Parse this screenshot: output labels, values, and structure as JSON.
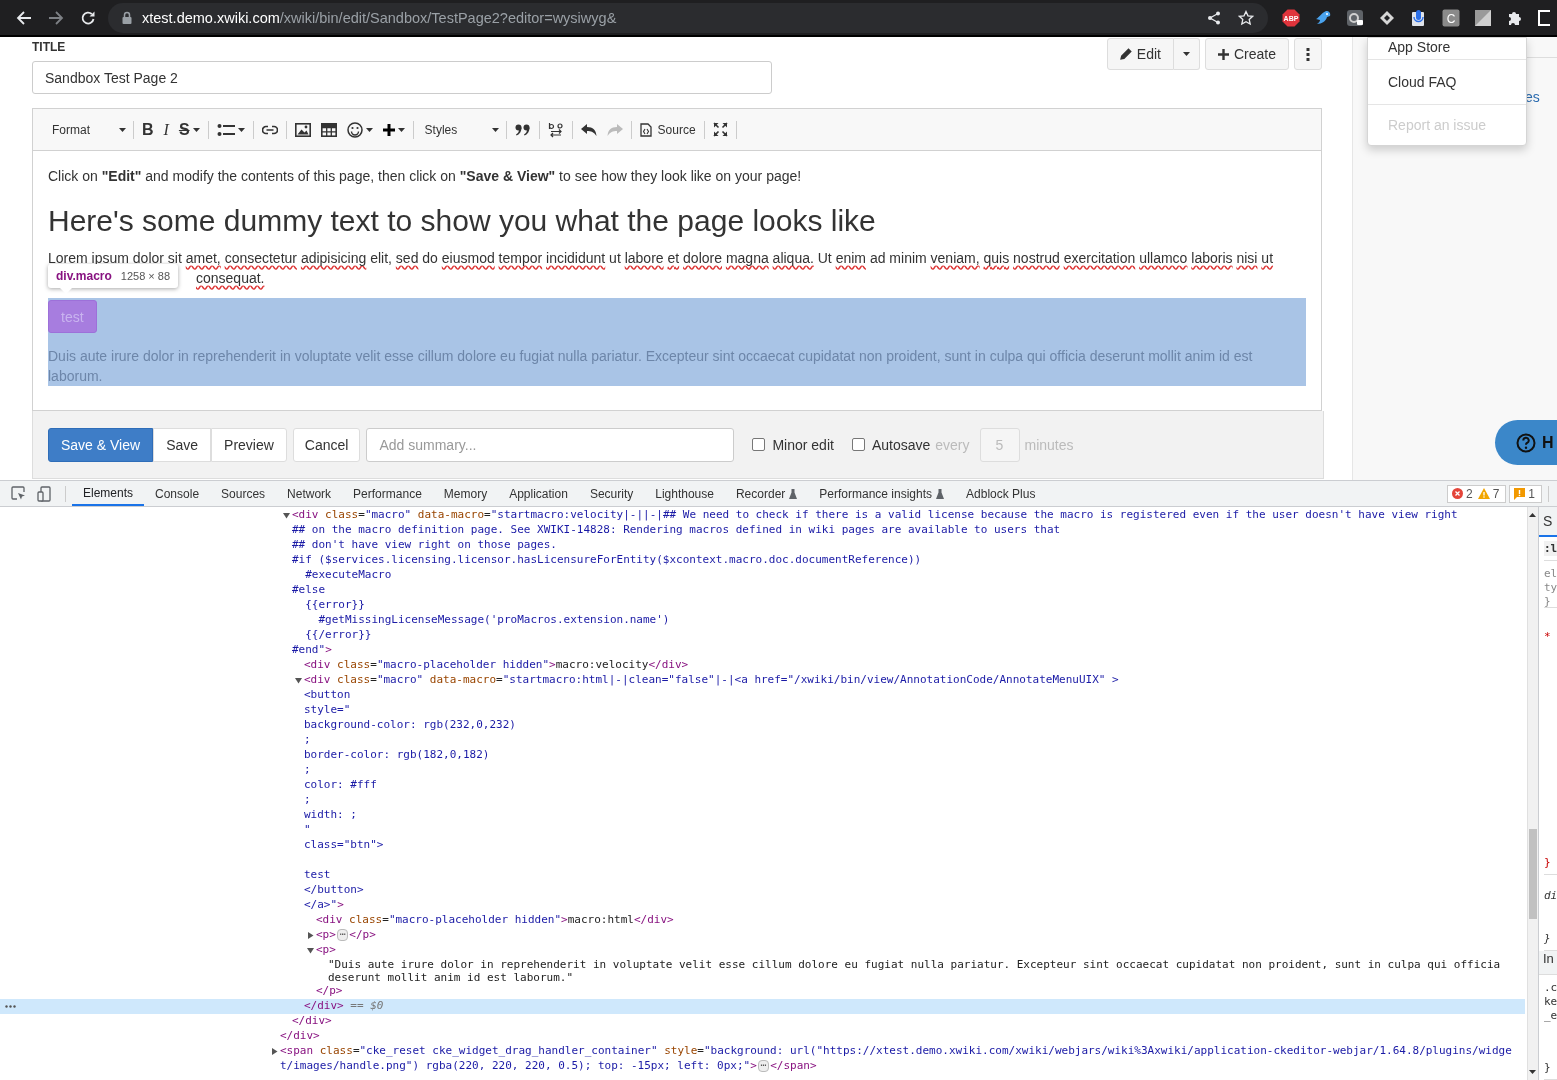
{
  "browser": {
    "host": "xtest.demo.xwiki.com",
    "path": "/xwiki/bin/edit/Sandbox/TestPage2?editor=wysiwyg&",
    "forward_disabled": true,
    "adblock_label": "ABP",
    "c_extension_label": "C"
  },
  "page": {
    "title_label": "TITLE",
    "title_value": "Sandbox Test Page 2",
    "actions": {
      "edit": "Edit",
      "create": "Create"
    },
    "toolbar": [
      [
        {
          "kind": "combo",
          "label": "Format"
        }
      ],
      [
        {
          "kind": "bold",
          "glyph": "B",
          "dropdown": false
        },
        {
          "kind": "italic",
          "glyph": "I",
          "dropdown": false
        },
        {
          "kind": "strike",
          "glyph": "S",
          "dropdown": true
        }
      ],
      [
        {
          "kind": "icon",
          "dropdown": true,
          "disabled": false
        }
      ],
      [
        {
          "kind": "icon",
          "dropdown": false,
          "disabled": false
        }
      ],
      [
        {
          "kind": "icon",
          "dropdown": false,
          "disabled": false
        },
        {
          "kind": "icon",
          "dropdown": false,
          "disabled": false
        },
        {
          "kind": "icon",
          "dropdown": true,
          "disabled": false
        },
        {
          "kind": "icon",
          "dropdown": true,
          "disabled": false
        }
      ],
      [
        {
          "kind": "combo",
          "label": "Styles"
        }
      ],
      [
        {
          "kind": "icon",
          "dropdown": false,
          "disabled": false
        }
      ],
      [
        {
          "kind": "icon",
          "dropdown": false,
          "disabled": false
        }
      ],
      [
        {
          "kind": "icon",
          "dropdown": false,
          "disabled": false
        },
        {
          "kind": "icon",
          "dropdown": false,
          "disabled": true
        }
      ],
      [
        {
          "kind": "labeled",
          "label": "Source",
          "dropdown": false,
          "disabled": false
        }
      ],
      [
        {
          "kind": "icon",
          "dropdown": false,
          "disabled": false
        }
      ]
    ],
    "content": {
      "intro": "Click on **\"Edit\"** and modify the contents of this page, then click on **\"Save & View\"** to see how they look like on your page!",
      "heading": "Here's some dummy text to show you what the page looks like",
      "lorem": [
        [
          {
            "text": "Lorem ipsum dolor sit",
            "misspelled": false
          },
          {
            "text": "amet,",
            "misspelled": true
          },
          {
            "text": "consectetur",
            "misspelled": true
          },
          {
            "text": "adipisicing",
            "misspelled": true
          },
          {
            "text": "elit,",
            "misspelled": false
          },
          {
            "text": "sed",
            "misspelled": true
          },
          {
            "text": "do",
            "misspelled": false
          },
          {
            "text": "eiusmod",
            "misspelled": true
          },
          {
            "text": "tempor",
            "misspelled": true
          },
          {
            "text": "incididunt",
            "misspelled": true
          },
          {
            "text": "ut",
            "misspelled": false
          },
          {
            "text": "labore",
            "misspelled": true
          },
          {
            "text": "et",
            "misspelled": true
          },
          {
            "text": "dolore",
            "misspelled": true
          },
          {
            "text": "magna",
            "misspelled": true
          },
          {
            "text": "aliqua.",
            "misspelled": true
          },
          {
            "text": "Ut",
            "misspelled": false
          },
          {
            "text": "enim",
            "misspelled": true
          },
          {
            "text": "ad minim",
            "misspelled": false
          },
          {
            "text": "veniam,",
            "misspelled": true
          },
          {
            "text": "quis",
            "misspelled": true
          },
          {
            "text": "nostrud",
            "misspelled": true
          },
          {
            "text": "exercitation",
            "misspelled": true
          },
          {
            "text": "ullamco",
            "misspelled": true
          },
          {
            "text": "laboris",
            "misspelled": true
          },
          {
            "text": "nisi",
            "misspelled": true
          },
          {
            "text": "ut",
            "misspelled": true
          }
        ],
        [
          {
            "text": "consequat.",
            "misspelled": true
          }
        ]
      ],
      "tooltip": {
        "selector": "div.macro",
        "size": "1258 × 88"
      },
      "macro": {
        "selected": true,
        "button": "test",
        "text": "Duis aute irure dolor in reprehenderit in voluptate velit esse cillum dolore eu fugiat nulla pariatur. Excepteur sint occaecat cupidatat non proident, sunt in culpa qui officia deserunt mollit anim id est laborum."
      }
    },
    "footer": {
      "button_groups": [
        [
          {
            "label": "Save & View",
            "primary": true
          },
          {
            "label": "Save",
            "primary": false
          },
          {
            "label": "Preview",
            "primary": false
          }
        ],
        [
          {
            "label": "Cancel",
            "primary": false
          }
        ]
      ],
      "summary": {
        "placeholder": "Add summary..."
      },
      "minor_edit": {
        "label": "Minor edit",
        "checked": false
      },
      "autosave": {
        "label": "Autosave",
        "checked": false,
        "prefix": "every",
        "interval": "5",
        "suffix": "minutes"
      }
    }
  },
  "side_panel": {
    "link": "es",
    "menu": [
      {
        "label": "App Store",
        "disabled": false
      },
      {
        "label": "Cloud FAQ",
        "disabled": false
      },
      {
        "label": "Report an issue",
        "disabled": true
      }
    ],
    "help_button": "H"
  },
  "devtools": {
    "tabs": [
      {
        "label": "Elements",
        "selected": true,
        "experimental": false
      },
      {
        "label": "Console",
        "selected": false,
        "experimental": false
      },
      {
        "label": "Sources",
        "selected": false,
        "experimental": false
      },
      {
        "label": "Network",
        "selected": false,
        "experimental": false
      },
      {
        "label": "Performance",
        "selected": false,
        "experimental": false
      },
      {
        "label": "Memory",
        "selected": false,
        "experimental": false
      },
      {
        "label": "Application",
        "selected": false,
        "experimental": false
      },
      {
        "label": "Security",
        "selected": false,
        "experimental": false
      },
      {
        "label": "Lighthouse",
        "selected": false,
        "experimental": false
      },
      {
        "label": "Recorder",
        "selected": false,
        "experimental": true
      },
      {
        "label": "Performance insights",
        "selected": false,
        "experimental": true
      },
      {
        "label": "Adblock Plus",
        "selected": false,
        "experimental": false
      }
    ],
    "counts": {
      "errors": "2",
      "warnings": "7",
      "issues": "1"
    },
    "tree": [
      {
        "kind": "element",
        "selected": false,
        "children": [
          {
            "kind": "element",
            "expanded": true,
            "selected": false,
            "lines": [
              [
                {
                  "kind": "tag",
                  "text": "<div"
                },
                {
                  "kind": "attr",
                  "text": " class"
                },
                {
                  "kind": "punct",
                  "text": "="
                },
                {
                  "kind": "val",
                  "text": "\"macro\""
                },
                {
                  "kind": "attr",
                  "text": " data-macro"
                },
                {
                  "kind": "punct",
                  "text": "="
                },
                {
                  "kind": "val",
                  "text": "\"startmacro:velocity|-||-|## We need to check if there is a valid license because the macro is registered even if the user doesn't have view right"
                }
              ],
              [
                {
                  "kind": "val",
                  "text": "## on the macro definition page. See XWIKI-14828: Rendering macros defined in wiki pages are available to users that"
                }
              ],
              [
                {
                  "kind": "val",
                  "text": "## don't have view right on those pages."
                }
              ],
              [
                {
                  "kind": "val",
                  "text": "#if ($services.licensing.licensor.hasLicensureForEntity($xcontext.macro.doc.documentReference))"
                }
              ],
              [
                {
                  "kind": "val",
                  "text": "  #executeMacro"
                }
              ],
              [
                {
                  "kind": "val",
                  "text": "#else"
                }
              ],
              [
                {
                  "kind": "val",
                  "text": "  {{error}}"
                }
              ],
              [
                {
                  "kind": "val",
                  "text": "    #getMissingLicenseMessage('proMacros.extension.name')"
                }
              ],
              [
                {
                  "kind": "val",
                  "text": "  {{/error}}"
                }
              ],
              [
                {
                  "kind": "val",
                  "text": "#end\""
                },
                {
                  "kind": "tag",
                  "text": ">"
                }
              ]
            ],
            "children": [
              {
                "kind": "element",
                "selected": false,
                "lines": [
                  [
                    {
                      "kind": "tag",
                      "text": "<div"
                    },
                    {
                      "kind": "attr",
                      "text": " class"
                    },
                    {
                      "kind": "punct",
                      "text": "="
                    },
                    {
                      "kind": "val",
                      "text": "\"macro-placeholder hidden\""
                    },
                    {
                      "kind": "tag",
                      "text": ">"
                    },
                    {
                      "kind": "text",
                      "text": "macro:velocity"
                    },
                    {
                      "kind": "tag",
                      "text": "</div>"
                    }
                  ]
                ]
              },
              {
                "kind": "element",
                "expanded": true,
                "selected": true,
                "lines": [
                  [
                    {
                      "kind": "tag",
                      "text": "<div"
                    },
                    {
                      "kind": "attr",
                      "text": " class"
                    },
                    {
                      "kind": "punct",
                      "text": "="
                    },
                    {
                      "kind": "val",
                      "text": "\"macro\""
                    },
                    {
                      "kind": "attr",
                      "text": " data-macro"
                    },
                    {
                      "kind": "punct",
                      "text": "="
                    },
                    {
                      "kind": "val",
                      "text": "\"startmacro:html|-|clean=\"false\"|-|<a href=\"/xwiki/bin/view/AnnotationCode/AnnotateMenuUIX\" >"
                    }
                  ],
                  [
                    {
                      "kind": "val",
                      "text": "<button"
                    }
                  ],
                  [
                    {
                      "kind": "val",
                      "text": "style=\""
                    }
                  ],
                  [
                    {
                      "kind": "val",
                      "text": "background-color: rgb(232,0,232)"
                    }
                  ],
                  [
                    {
                      "kind": "val",
                      "text": ";"
                    }
                  ],
                  [
                    {
                      "kind": "val",
                      "text": "border-color: rgb(182,0,182)"
                    }
                  ],
                  [
                    {
                      "kind": "val",
                      "text": ";"
                    }
                  ],
                  [
                    {
                      "kind": "val",
                      "text": "color: #fff"
                    }
                  ],
                  [
                    {
                      "kind": "val",
                      "text": ";"
                    }
                  ],
                  [
                    {
                      "kind": "val",
                      "text": "width: ;"
                    }
                  ],
                  [
                    {
                      "kind": "val",
                      "text": "\""
                    }
                  ],
                  [
                    {
                      "kind": "val",
                      "text": "class=\"btn\">"
                    }
                  ],
                  [
                    {
                      "kind": "blank"
                    }
                  ],
                  [
                    {
                      "kind": "val",
                      "text": "test"
                    }
                  ],
                  [
                    {
                      "kind": "val",
                      "text": "</button>"
                    }
                  ],
                  [
                    {
                      "kind": "val",
                      "text": "</a>\""
                    },
                    {
                      "kind": "tag",
                      "text": ">"
                    }
                  ]
                ],
                "children": [
                  {
                    "kind": "element",
                    "selected": false,
                    "lines": [
                      [
                        {
                          "kind": "tag",
                          "text": "<div"
                        },
                        {
                          "kind": "attr",
                          "text": " class"
                        },
                        {
                          "kind": "punct",
                          "text": "="
                        },
                        {
                          "kind": "val",
                          "text": "\"macro-placeholder hidden\""
                        },
                        {
                          "kind": "tag",
                          "text": ">"
                        },
                        {
                          "kind": "text",
                          "text": "macro:html"
                        },
                        {
                          "kind": "tag",
                          "text": "</div>"
                        }
                      ]
                    ]
                  },
                  {
                    "kind": "element",
                    "expanded": false,
                    "selected": false,
                    "lines": [
                      [
                        {
                          "kind": "tag",
                          "text": "<p>"
                        },
                        {
                          "kind": "badge",
                          "text": "⋯"
                        },
                        {
                          "kind": "tag",
                          "text": "</p>"
                        }
                      ]
                    ]
                  },
                  {
                    "kind": "element",
                    "expanded": true,
                    "selected": false,
                    "lines": [
                      [
                        {
                          "kind": "tag",
                          "text": "<p>"
                        }
                      ]
                    ],
                    "children": [
                      {
                        "kind": "text",
                        "lines": [
                          [
                            {
                              "kind": "text",
                              "text": "\"Duis aute irure dolor in reprehenderit in voluptate velit esse cillum dolore eu fugiat nulla pariatur. Excepteur sint occaecat cupidatat non proident, sunt in culpa qui officia deserunt mollit anim id est laborum.\""
                            }
                          ]
                        ]
                      }
                    ],
                    "close": [
                      {
                        "kind": "tag",
                        "text": "</p>"
                      }
                    ]
                  }
                ],
                "close": [
                  {
                    "kind": "tag",
                    "text": "</div>"
                  }
                ],
                "close_note": "== $0"
              }
            ],
            "close": [
              {
                "kind": "tag",
                "text": "</div>"
              }
            ]
          }
        ],
        "close": [
          {
            "kind": "tag",
            "text": "</div>"
          }
        ]
      },
      {
        "kind": "element",
        "expanded": false,
        "selected": false,
        "lines": [
          [
            {
              "kind": "tag",
              "text": "<span"
            },
            {
              "kind": "attr",
              "text": " class"
            },
            {
              "kind": "punct",
              "text": "="
            },
            {
              "kind": "val",
              "text": "\"cke_reset cke_widget_drag_handler_container\""
            },
            {
              "kind": "attr",
              "text": " style"
            },
            {
              "kind": "punct",
              "text": "="
            },
            {
              "kind": "val",
              "text": "\"background: url(\"https://xtest.demo.xwiki.com/xwiki/webjars/wiki%3Axwiki/application-ckeditor-webjar/1.64.8/plugins/widge"
            }
          ],
          [
            {
              "kind": "val",
              "text": "t/images/handle.png\") rgba(220, 220, 220, 0.5); top: -15px; left: 0px;\""
            },
            {
              "kind": "tag",
              "text": ">"
            },
            {
              "kind": "badge",
              "text": "⋯"
            },
            {
              "kind": "tag",
              "text": "</span>"
            }
          ]
        ]
      }
    ],
    "styles_pane": {
      "tab": "S",
      "filter": ":l",
      "rule_blocks": [
        [
          "el",
          "ty",
          "}"
        ],
        [
          "*",
          "}"
        ],
        [
          "di",
          "}"
        ]
      ],
      "section": "In",
      "section_blocks": [
        [
          ".c",
          "ke",
          "_e",
          "}"
        ]
      ]
    }
  }
}
